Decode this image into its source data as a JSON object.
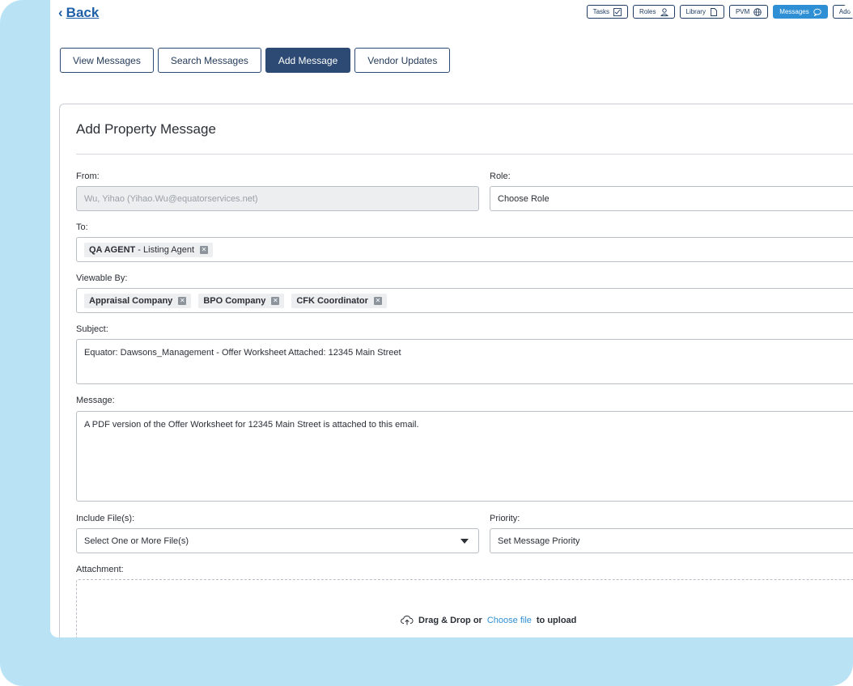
{
  "back_label": "Back",
  "topnav": [
    {
      "label": "Tasks",
      "icon": "check-square-icon"
    },
    {
      "label": "Roles",
      "icon": "person-icon"
    },
    {
      "label": "Library",
      "icon": "document-icon"
    },
    {
      "label": "PVM",
      "icon": "globe-icon"
    },
    {
      "label": "Messages",
      "icon": "chat-bubble-icon"
    },
    {
      "label": "Ado"
    }
  ],
  "tabs": [
    {
      "label": "View Messages"
    },
    {
      "label": "Search Messages"
    },
    {
      "label": "Add Message"
    },
    {
      "label": "Vendor Updates"
    }
  ],
  "form": {
    "title": "Add Property Message",
    "from_label": "From:",
    "from_value": "Wu, Yihao  (Yihao.Wu@equatorservices.net)",
    "role_label": "Role:",
    "role_value": "Choose Role",
    "to_label": "To:",
    "to_chips": [
      {
        "bold": "QA AGENT",
        "rest": " - Listing Agent"
      }
    ],
    "viewable_label": "Viewable By:",
    "viewable_chips": [
      "Appraisal Company",
      "BPO Company",
      "CFK Coordinator"
    ],
    "subject_label": "Subject:",
    "subject_value": "Equator: Dawsons_Management - Offer Worksheet Attached: 12345 Main Street",
    "message_label": "Message:",
    "message_value": "A PDF version of the Offer Worksheet for 12345 Main Street is attached to this email.",
    "files_label": "Include File(s):",
    "files_placeholder": "Select One or More File(s)",
    "priority_label": "Priority:",
    "priority_value": "Set Message Priority",
    "attachment_label": "Attachment:",
    "dropzone_prefix": "Drag & Drop or",
    "dropzone_link": "Choose file",
    "dropzone_suffix": "to upload"
  },
  "colors": {
    "accent": "#2e8fd4",
    "tab_active": "#2c4a73",
    "frame": "#b9e3f5"
  }
}
